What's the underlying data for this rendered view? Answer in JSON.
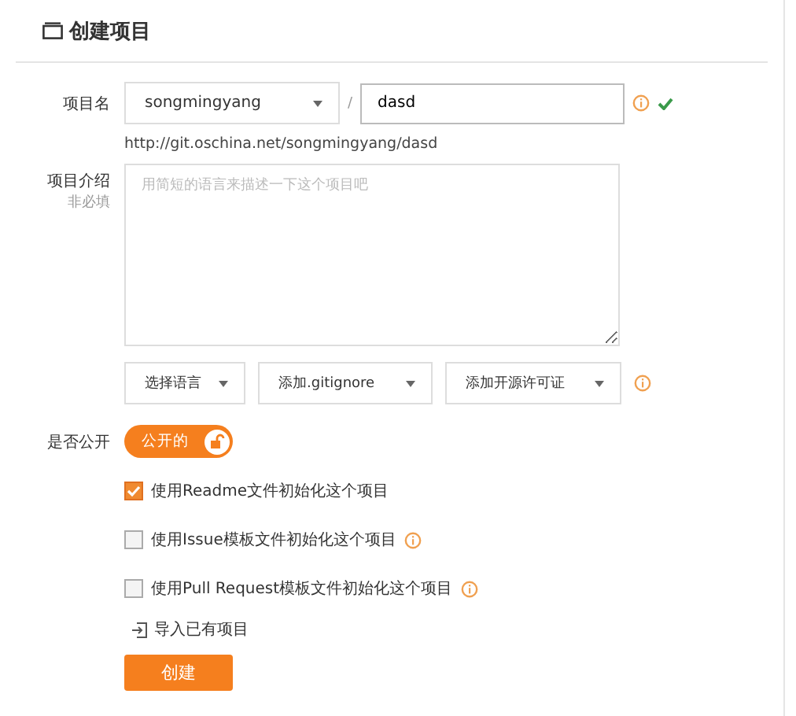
{
  "title": "创建项目",
  "name_row": {
    "label": "项目名",
    "owner": "songmingyang",
    "separator": "/",
    "value": "dasd",
    "valid": true
  },
  "url": "http://git.oschina.net/songmingyang/dasd",
  "description": {
    "label": "项目介绍",
    "hint": "非必填",
    "placeholder": "用简短的语言来描述一下这个项目吧"
  },
  "selects": [
    {
      "label": "选择语言"
    },
    {
      "label": "添加.gitignore"
    },
    {
      "label": "添加开源许可证"
    }
  ],
  "visibility": {
    "label": "是否公开",
    "toggle_label": "公开的",
    "on": true
  },
  "options": [
    {
      "label": "使用Readme文件初始化这个项目",
      "checked": true,
      "info": false
    },
    {
      "label": "使用Issue模板文件初始化这个项目",
      "checked": false,
      "info": true
    },
    {
      "label": "使用Pull Request模板文件初始化这个项目",
      "checked": false,
      "info": true
    }
  ],
  "import_link": "导入已有项目",
  "submit": "创建"
}
